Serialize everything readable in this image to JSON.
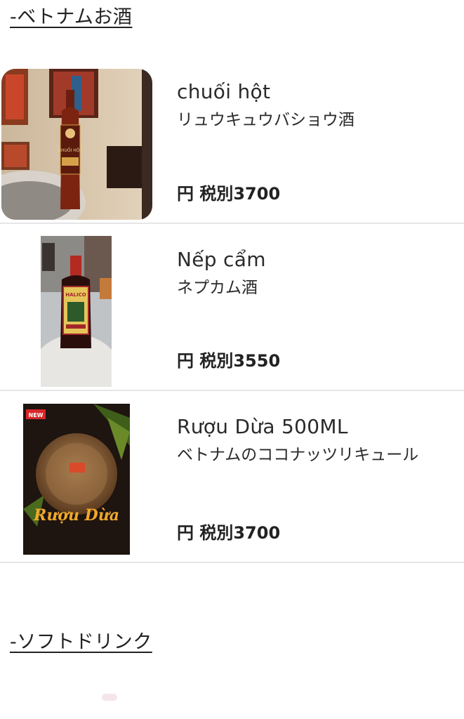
{
  "sections": [
    {
      "heading": "-ベトナムお酒"
    },
    {
      "heading": "-ソフトドリンク"
    }
  ],
  "items": [
    {
      "name": "chuối hột",
      "description": "リュウキュウバショウ酒",
      "price": "円 税別3700",
      "image_label": "CHUỐI HỘT"
    },
    {
      "name": "Nếp cẩm",
      "description": "ネプカム酒",
      "price": "円 税別3550",
      "image_label": "HALICO"
    },
    {
      "name": "Rượu Dừa 500ML",
      "description": "ベトナムのココナッツリキュール",
      "price": "円 税別3700",
      "image_badge": "NEW",
      "image_label": "Rượu Dừa"
    }
  ]
}
